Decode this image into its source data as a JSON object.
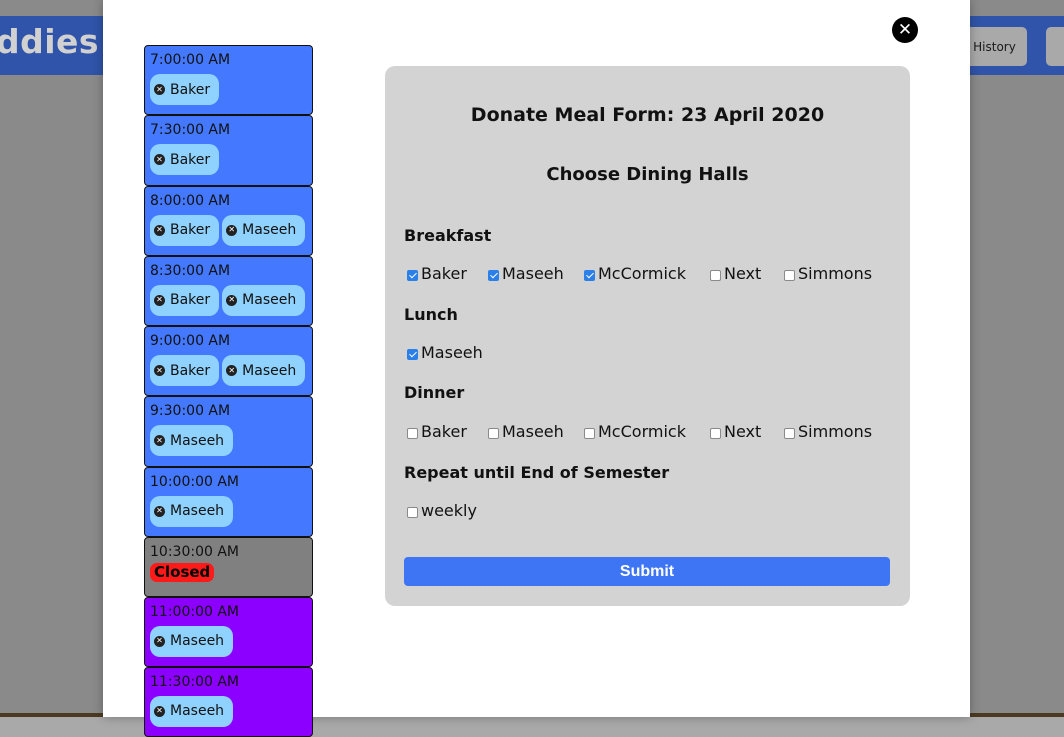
{
  "background": {
    "logo_text": "ddies",
    "history_button": "History"
  },
  "slots": [
    {
      "time": "7:00:00 AM",
      "halls": [
        "Baker"
      ]
    },
    {
      "time": "7:30:00 AM",
      "halls": [
        "Baker"
      ]
    },
    {
      "time": "8:00:00 AM",
      "halls": [
        "Baker",
        "Maseeh"
      ]
    },
    {
      "time": "8:30:00 AM",
      "halls": [
        "Baker",
        "Maseeh"
      ]
    },
    {
      "time": "9:00:00 AM",
      "halls": [
        "Baker",
        "Maseeh"
      ]
    },
    {
      "time": "9:30:00 AM",
      "halls": [
        "Maseeh"
      ]
    },
    {
      "time": "10:00:00 AM",
      "halls": [
        "Maseeh"
      ]
    },
    {
      "time": "10:30:00 AM",
      "closed_label": "Closed"
    },
    {
      "time": "11:00:00 AM",
      "halls": [
        "Maseeh"
      ]
    },
    {
      "time": "11:30:00 AM",
      "halls": [
        "Maseeh"
      ]
    }
  ],
  "slot_colors": {
    "open": "#4479ff",
    "closed": "#808080",
    "later": "#8c00ff",
    "chip": "#8fd2ff",
    "closed_badge": "#ff1a1a"
  },
  "form": {
    "title": "Donate Meal Form: 23 April 2020",
    "subtitle": "Choose Dining Halls",
    "breakfast": {
      "label": "Breakfast",
      "options": [
        {
          "label": "Baker",
          "checked": true
        },
        {
          "label": "Maseeh",
          "checked": true
        },
        {
          "label": "McCormick",
          "checked": true
        },
        {
          "label": "Next",
          "checked": false
        },
        {
          "label": "Simmons",
          "checked": false
        }
      ]
    },
    "lunch": {
      "label": "Lunch",
      "options": [
        {
          "label": "Maseeh",
          "checked": true
        }
      ]
    },
    "dinner": {
      "label": "Dinner",
      "options": [
        {
          "label": "Baker",
          "checked": false
        },
        {
          "label": "Maseeh",
          "checked": false
        },
        {
          "label": "McCormick",
          "checked": false
        },
        {
          "label": "Next",
          "checked": false
        },
        {
          "label": "Simmons",
          "checked": false
        }
      ]
    },
    "repeat": {
      "label": "Repeat until End of Semester",
      "options": [
        {
          "label": "weekly",
          "checked": false
        }
      ]
    },
    "submit_label": "Submit",
    "accent": "#3d75f5"
  },
  "icons": {
    "close": "close-circle-icon",
    "chip_remove": "remove-x-icon"
  }
}
